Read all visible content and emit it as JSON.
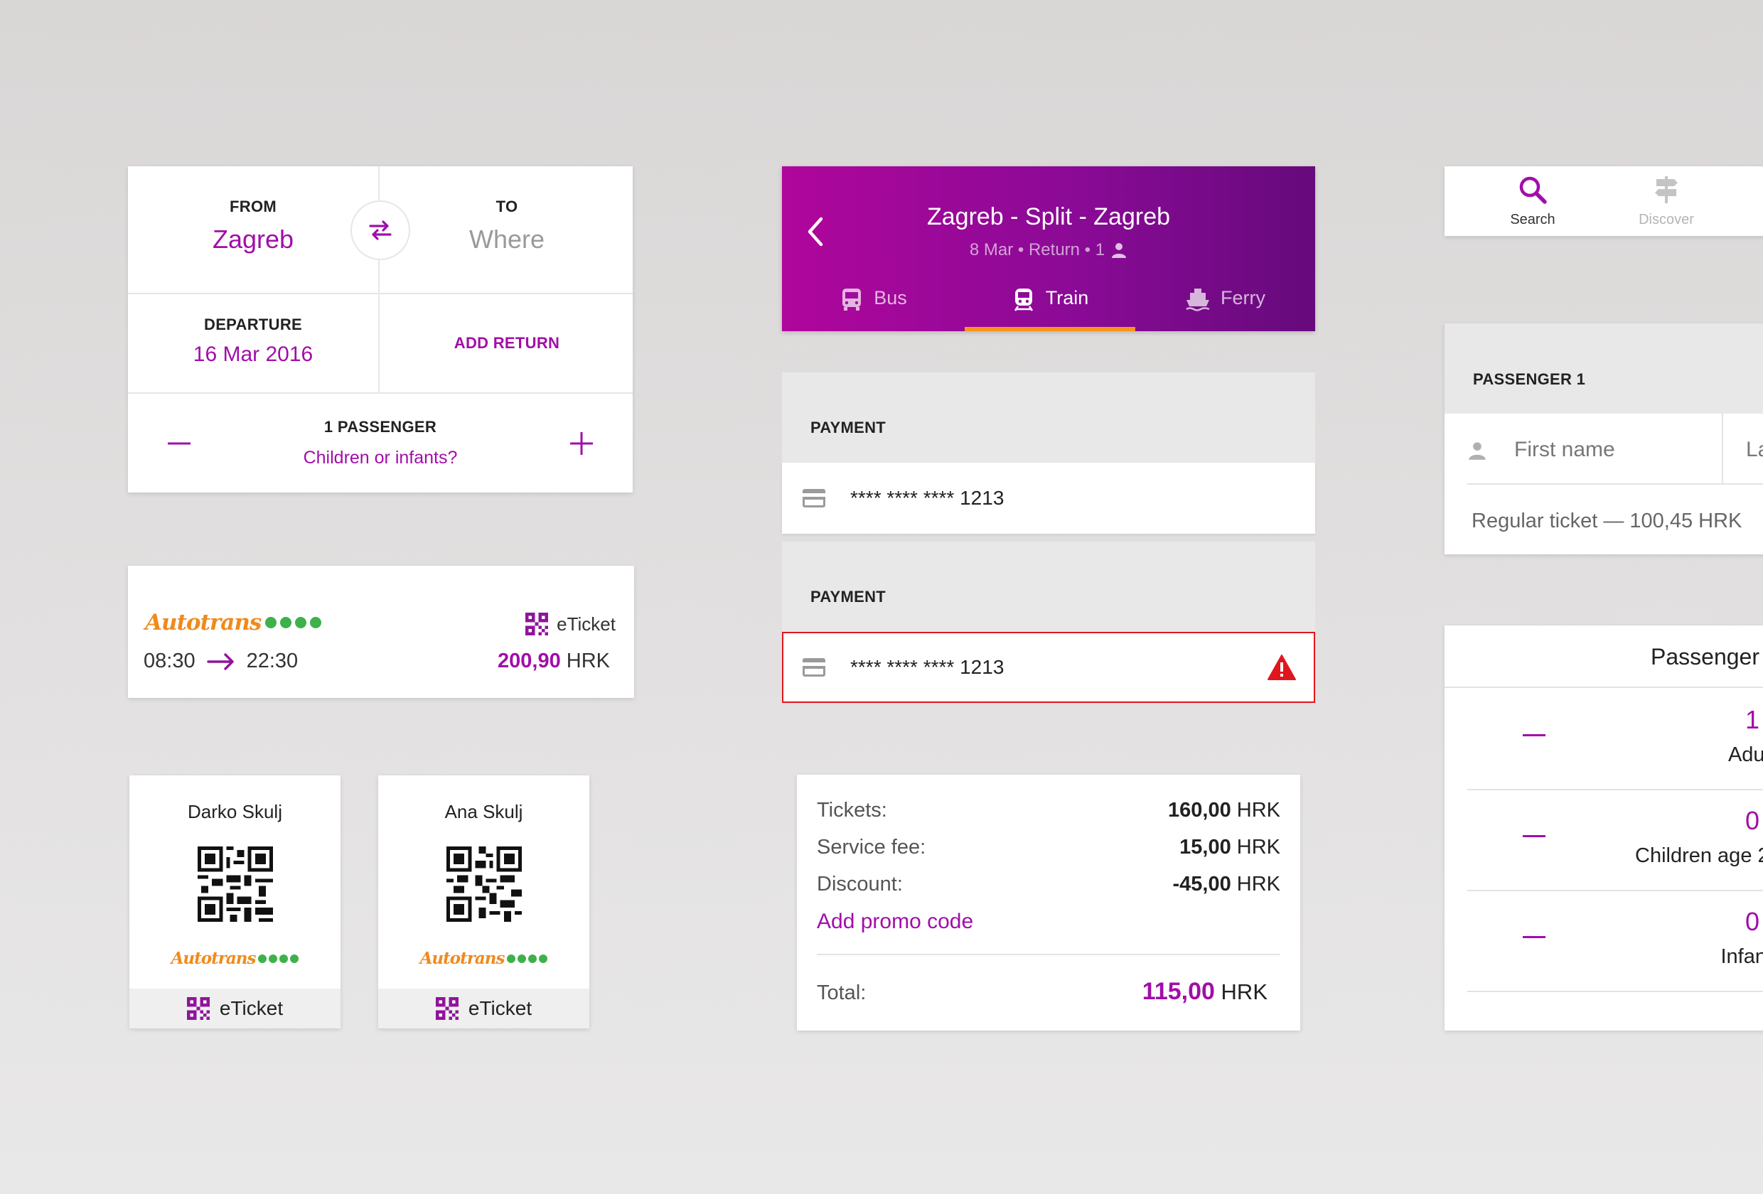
{
  "search": {
    "from_label": "FROM",
    "from_value": "Zagreb",
    "to_label": "TO",
    "to_value": "Where",
    "departure_label": "DEPARTURE",
    "departure_value": "16 Mar 2016",
    "add_return_label": "ADD RETURN",
    "passenger_count_label": "1 PASSENGER",
    "children_link": "Children or infants?"
  },
  "result": {
    "brand": "Autotrans",
    "eticket_label": "eTicket",
    "depart_time": "08:30",
    "arrive_time": "22:30",
    "price": "200,90",
    "currency": "HRK"
  },
  "person_tickets": [
    {
      "name": "Darko Skulj",
      "brand": "Autotrans",
      "eticket_label": "eTicket"
    },
    {
      "name": "Ana Skulj",
      "brand": "Autotrans",
      "eticket_label": "eTicket"
    }
  ],
  "trip": {
    "title": "Zagreb - Split - Zagreb",
    "subtitle": "8 Mar • Return • 1",
    "tabs": [
      {
        "label": "Bus",
        "icon": "bus-icon",
        "active": false
      },
      {
        "label": "Train",
        "icon": "train-icon",
        "active": true
      },
      {
        "label": "Ferry",
        "icon": "ferry-icon",
        "active": false
      }
    ]
  },
  "payments": [
    {
      "heading": "PAYMENT",
      "card_number": "**** **** **** 1213",
      "error": false
    },
    {
      "heading": "PAYMENT",
      "card_number": "**** **** **** 1213",
      "error": true
    }
  ],
  "totals": {
    "tickets_label": "Tickets:",
    "tickets_amount": "160,00",
    "service_fee_label": "Service fee:",
    "service_fee_amount": "15,00",
    "discount_label": "Discount:",
    "discount_amount": "-45,00",
    "currency": "HRK",
    "promo_link": "Add promo code",
    "total_label": "Total:",
    "total_amount": "115,00"
  },
  "nav": {
    "items": [
      {
        "label": "Search",
        "icon": "search-icon",
        "active": true
      },
      {
        "label": "Discover",
        "icon": "signpost-icon",
        "active": false
      }
    ]
  },
  "passenger_details": {
    "heading": "PASSENGER 1",
    "first_name_placeholder": "First name",
    "last_name_placeholder": "Las",
    "ticket_info": "Regular ticket — 100,45 HRK"
  },
  "passengers_panel": {
    "title": "Passenger",
    "rows": [
      {
        "count": "1",
        "label": "Adult"
      },
      {
        "count": "0",
        "label": "Children age 2"
      },
      {
        "count": "0",
        "label": "Infants"
      }
    ]
  },
  "colors": {
    "accent": "#a10ea9",
    "orange": "#f08a1c",
    "green": "#3eb14a",
    "error": "#e0161d",
    "tab_indicator": "#f7941d"
  }
}
